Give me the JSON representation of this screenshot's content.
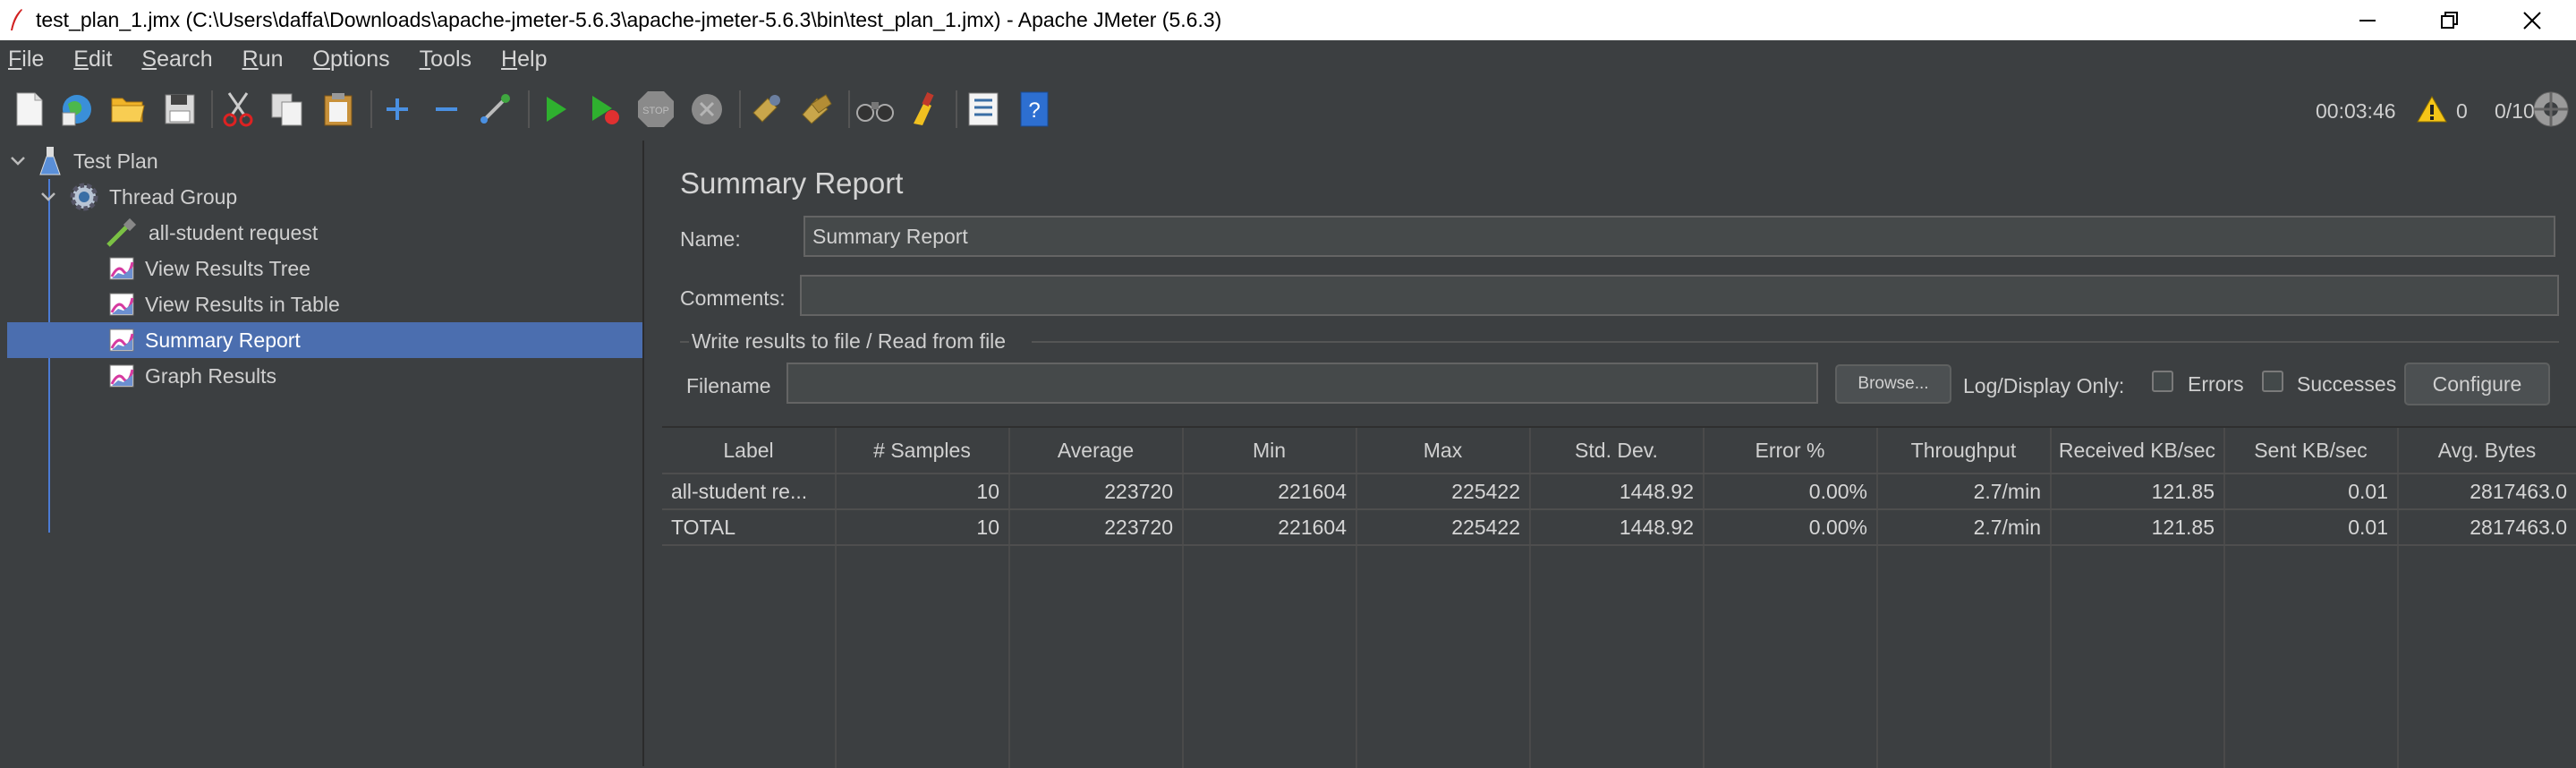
{
  "window": {
    "title": "test_plan_1.jmx (C:\\Users\\daffa\\Downloads\\apache-jmeter-5.6.3\\apache-jmeter-5.6.3\\bin\\test_plan_1.jmx) - Apache JMeter (5.6.3)"
  },
  "menu": [
    {
      "u": "F",
      "rest": "ile"
    },
    {
      "u": "E",
      "rest": "dit"
    },
    {
      "u": "S",
      "rest": "earch"
    },
    {
      "u": "R",
      "rest": "un"
    },
    {
      "u": "O",
      "rest": "ptions"
    },
    {
      "u": "T",
      "rest": "ools"
    },
    {
      "u": "H",
      "rest": "elp"
    }
  ],
  "toolbar_icons": [
    "new-icon",
    "templates-icon",
    "open-icon",
    "save-icon",
    "cut-icon",
    "copy-icon",
    "paste-icon",
    "expand-icon",
    "collapse-icon",
    "toggle-icon",
    "start-icon",
    "start-no-pauses-icon",
    "stop-icon",
    "shutdown-icon",
    "clear-icon",
    "clear-all-icon",
    "search-icon",
    "reset-search-icon",
    "function-helper-icon",
    "help-icon"
  ],
  "status": {
    "elapsed": "00:03:46",
    "warnings": "0",
    "threads": "0/10"
  },
  "tree": {
    "items": [
      {
        "label": "Test Plan",
        "icon": "flask-icon"
      },
      {
        "label": "Thread Group",
        "icon": "gear-icon"
      },
      {
        "label": "all-student request",
        "icon": "pipette-icon"
      },
      {
        "label": "View Results Tree",
        "icon": "graph-icon"
      },
      {
        "label": "View Results in Table",
        "icon": "graph-icon"
      },
      {
        "label": "Summary Report",
        "icon": "graph-icon",
        "selected": true
      },
      {
        "label": "Graph Results",
        "icon": "graph-icon"
      }
    ]
  },
  "panel": {
    "header": "Summary Report",
    "name_label": "Name:",
    "name_value": "Summary Report",
    "comments_label": "Comments:",
    "comments_value": "",
    "file_group_title": "Write results to file / Read from file",
    "filename_label": "Filename",
    "filename_value": "",
    "browse_label": "Browse...",
    "log_display_label": "Log/Display Only:",
    "errors_label": "Errors",
    "successes_label": "Successes",
    "configure_label": "Configure"
  },
  "table": {
    "columns": [
      "Label",
      "# Samples",
      "Average",
      "Min",
      "Max",
      "Std. Dev.",
      "Error %",
      "Throughput",
      "Received KB/sec",
      "Sent KB/sec",
      "Avg. Bytes"
    ],
    "rows": [
      [
        "all-student re...",
        "10",
        "223720",
        "221604",
        "225422",
        "1448.92",
        "0.00%",
        "2.7/min",
        "121.85",
        "0.01",
        "2817463.0"
      ],
      [
        "TOTAL",
        "10",
        "223720",
        "221604",
        "225422",
        "1448.92",
        "0.00%",
        "2.7/min",
        "121.85",
        "0.01",
        "2817463.0"
      ]
    ]
  },
  "colors": {
    "background": "#3c3f41",
    "selection": "#4b6eaf",
    "tree_line": "#4b7bd4"
  }
}
